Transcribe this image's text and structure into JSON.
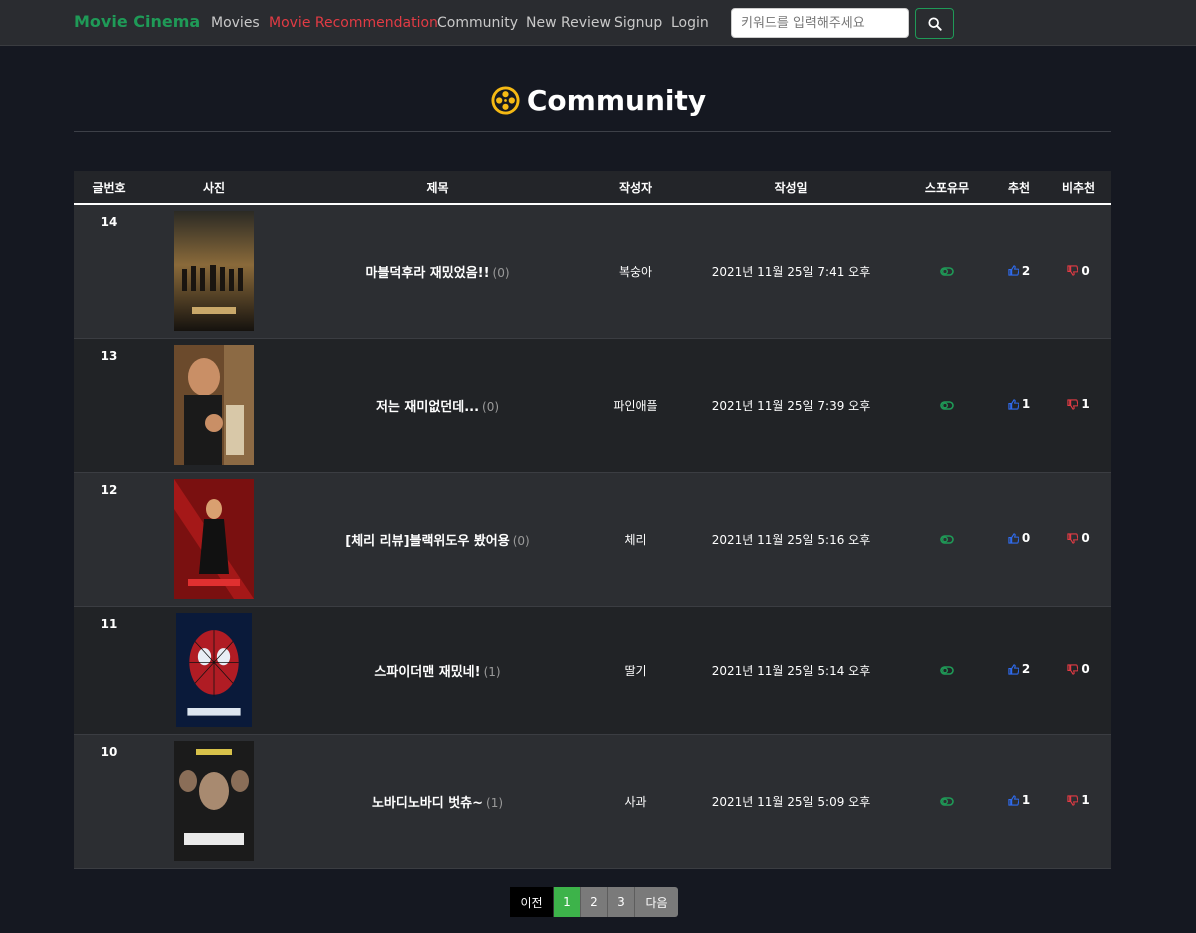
{
  "nav": {
    "brand": "Movie Cinema",
    "links": [
      "Movies",
      "Movie Recommendation",
      "Community",
      "New Review",
      "Signup",
      "Login"
    ],
    "active_link": "Movie Recommendation",
    "search_placeholder": "키워드를 입력해주세요",
    "search_icon": "search-icon"
  },
  "page": {
    "title": "Community",
    "title_icon": "film-reel-icon"
  },
  "table": {
    "headers": [
      "글번호",
      "사진",
      "제목",
      "작성자",
      "작성일",
      "스포유무",
      "추천",
      "비추천"
    ],
    "rows": [
      {
        "no": "14",
        "title": "마블덕후라 재밌었음!!",
        "comments": "(0)",
        "author": "복숭아",
        "date": "2021년 11월 25일 7:41 오후",
        "likes": "2",
        "dislikes": "0"
      },
      {
        "no": "13",
        "title": "저는 재미없던데...",
        "comments": "(0)",
        "author": "파인애플",
        "date": "2021년 11월 25일 7:39 오후",
        "likes": "1",
        "dislikes": "1"
      },
      {
        "no": "12",
        "title": "[체리 리뷰]블랙위도우 봤어용",
        "comments": "(0)",
        "author": "체리",
        "date": "2021년 11월 25일 5:16 오후",
        "likes": "0",
        "dislikes": "0"
      },
      {
        "no": "11",
        "title": "스파이더맨 재밌네!",
        "comments": "(1)",
        "author": "딸기",
        "date": "2021년 11월 25일 5:14 오후",
        "likes": "2",
        "dislikes": "0"
      },
      {
        "no": "10",
        "title": "노바디노바디 벗츄~",
        "comments": "(1)",
        "author": "사과",
        "date": "2021년 11월 25일 5:09 오후",
        "likes": "1",
        "dislikes": "1"
      }
    ]
  },
  "pagination": {
    "prev": "이전",
    "pages": [
      "1",
      "2",
      "3"
    ],
    "current": "1",
    "next": "다음"
  },
  "colors": {
    "brand": "#1f9a57",
    "active_nav": "#e23b44",
    "like": "#2f6cf0",
    "dislike": "#e23b44",
    "spoiler": "#1f9a57",
    "current_page": "#3db34a"
  }
}
